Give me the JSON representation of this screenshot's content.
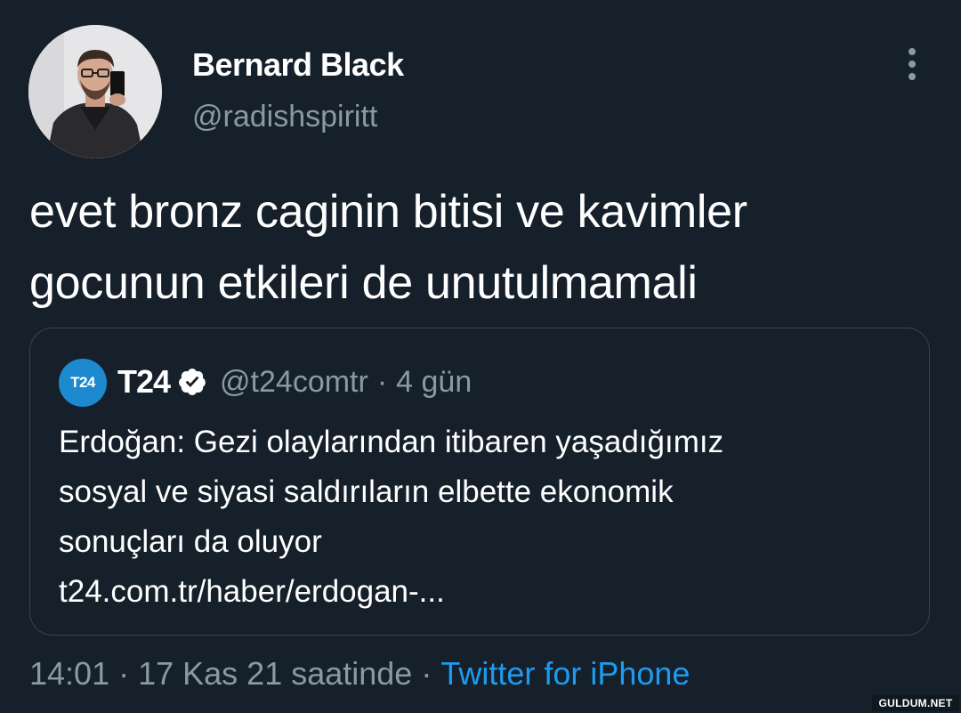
{
  "author": {
    "display_name": "Bernard Black",
    "handle": "@radishspiritt",
    "avatar_icon": "profile-photo"
  },
  "tweet": {
    "text": "evet bronz caginin bitisi ve kavimler gocunun etkileri de unutulmamali",
    "more_icon": "more-vertical-icon"
  },
  "quoted_tweet": {
    "logo_text": "T24",
    "name": "T24",
    "verified_icon": "verified-badge-icon",
    "handle": "@t24comtr",
    "separator": "·",
    "time": "4 gün",
    "text_lines": [
      "Erdoğan: Gezi olaylarından itibaren yaşadığımız",
      "sosyal ve siyasi saldırıların elbette ekonomik",
      "sonuçları da oluyor",
      "t24.com.tr/haber/erdogan-..."
    ]
  },
  "meta": {
    "time": "14:01",
    "separator": "·",
    "date": "17 Kas 21 saatinde",
    "source": "Twitter for iPhone"
  },
  "watermark": "GULDUM.NET",
  "colors": {
    "background": "#15202b",
    "text_primary": "#ffffff",
    "text_secondary": "#8b98a5",
    "link": "#1d9bf0",
    "border": "#38444d",
    "t24_logo": "#1d8ad0"
  }
}
